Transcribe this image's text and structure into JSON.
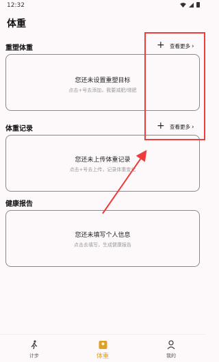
{
  "status": {
    "time": "12:32"
  },
  "page_title": "体重",
  "sections": [
    {
      "title": "重塑体重",
      "more": "查看更多",
      "card_title": "您还未设置重塑目标",
      "card_sub": "点击+号去添加，我要减肥/增肥"
    },
    {
      "title": "体重记录",
      "more": "查看更多",
      "card_title": "您还未上传体重记录",
      "card_sub": "点击+号去上传，记录体重变化"
    },
    {
      "title": "健康报告",
      "card_title": "您还未填写个人信息",
      "card_sub": "点击去填写，生成健康报告"
    }
  ],
  "plus_label": "+",
  "chevron": "›",
  "tabs": [
    {
      "label": "计步",
      "icon": "walking-person-icon"
    },
    {
      "label": "体重",
      "icon": "scale-icon",
      "active": true
    },
    {
      "label": "我的",
      "icon": "profile-icon"
    }
  ],
  "colors": {
    "accent": "#e0a020",
    "highlight": "#ee3b3b"
  }
}
